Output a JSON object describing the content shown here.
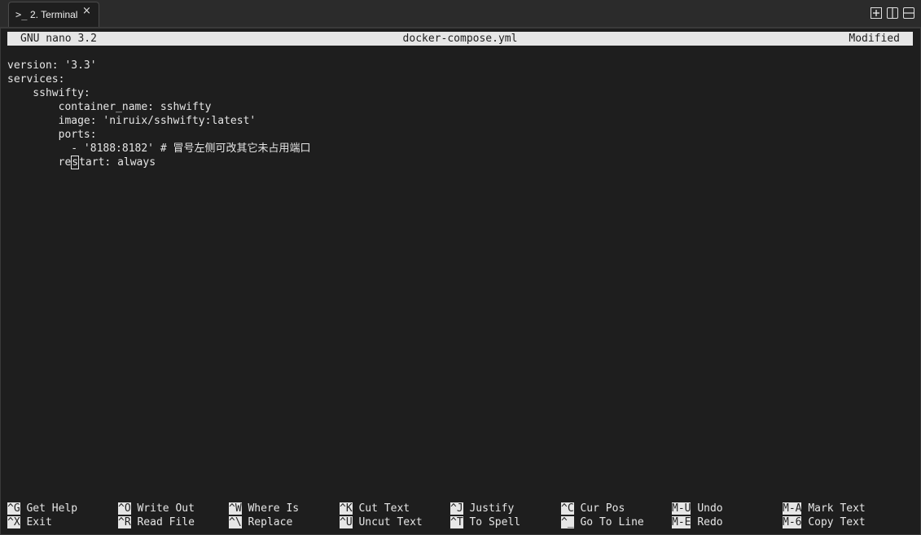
{
  "tab": {
    "icon": "terminal-prompt-icon",
    "icon_glyph": ">_",
    "label": "2. Terminal",
    "close_glyph": "×"
  },
  "window_controls": [
    "new-tab-icon",
    "split-vertical-icon",
    "split-horizontal-icon"
  ],
  "nano": {
    "version": "GNU nano 3.2",
    "filename": "docker-compose.yml",
    "status": "Modified"
  },
  "editor": {
    "lines": [
      "version: '3.3'",
      "services:",
      "    sshwifty:",
      "        container_name: sshwifty",
      "        image: 'niruix/sshwifty:latest'",
      "        ports:",
      "          - '8188:8182' # 冒号左侧可改其它未占用端口"
    ],
    "cursor_line_before": "        re",
    "cursor_char": "s",
    "cursor_line_after": "tart: always"
  },
  "shortcuts": [
    {
      "key": "^G",
      "label": "Get Help"
    },
    {
      "key": "^X",
      "label": "Exit"
    },
    {
      "key": "^O",
      "label": "Write Out"
    },
    {
      "key": "^R",
      "label": "Read File"
    },
    {
      "key": "^W",
      "label": "Where Is"
    },
    {
      "key": "^\\",
      "label": "Replace"
    },
    {
      "key": "^K",
      "label": "Cut Text"
    },
    {
      "key": "^U",
      "label": "Uncut Text"
    },
    {
      "key": "^J",
      "label": "Justify"
    },
    {
      "key": "^T",
      "label": "To Spell"
    },
    {
      "key": "^C",
      "label": "Cur Pos"
    },
    {
      "key": "^_",
      "label": "Go To Line"
    },
    {
      "key": "M-U",
      "label": "Undo"
    },
    {
      "key": "M-E",
      "label": "Redo"
    },
    {
      "key": "M-A",
      "label": "Mark Text"
    },
    {
      "key": "M-6",
      "label": "Copy Text"
    }
  ],
  "colors": {
    "background": "#1e1e1e",
    "foreground": "#e6e6e6",
    "inverse_bg": "#e6e6e6"
  }
}
